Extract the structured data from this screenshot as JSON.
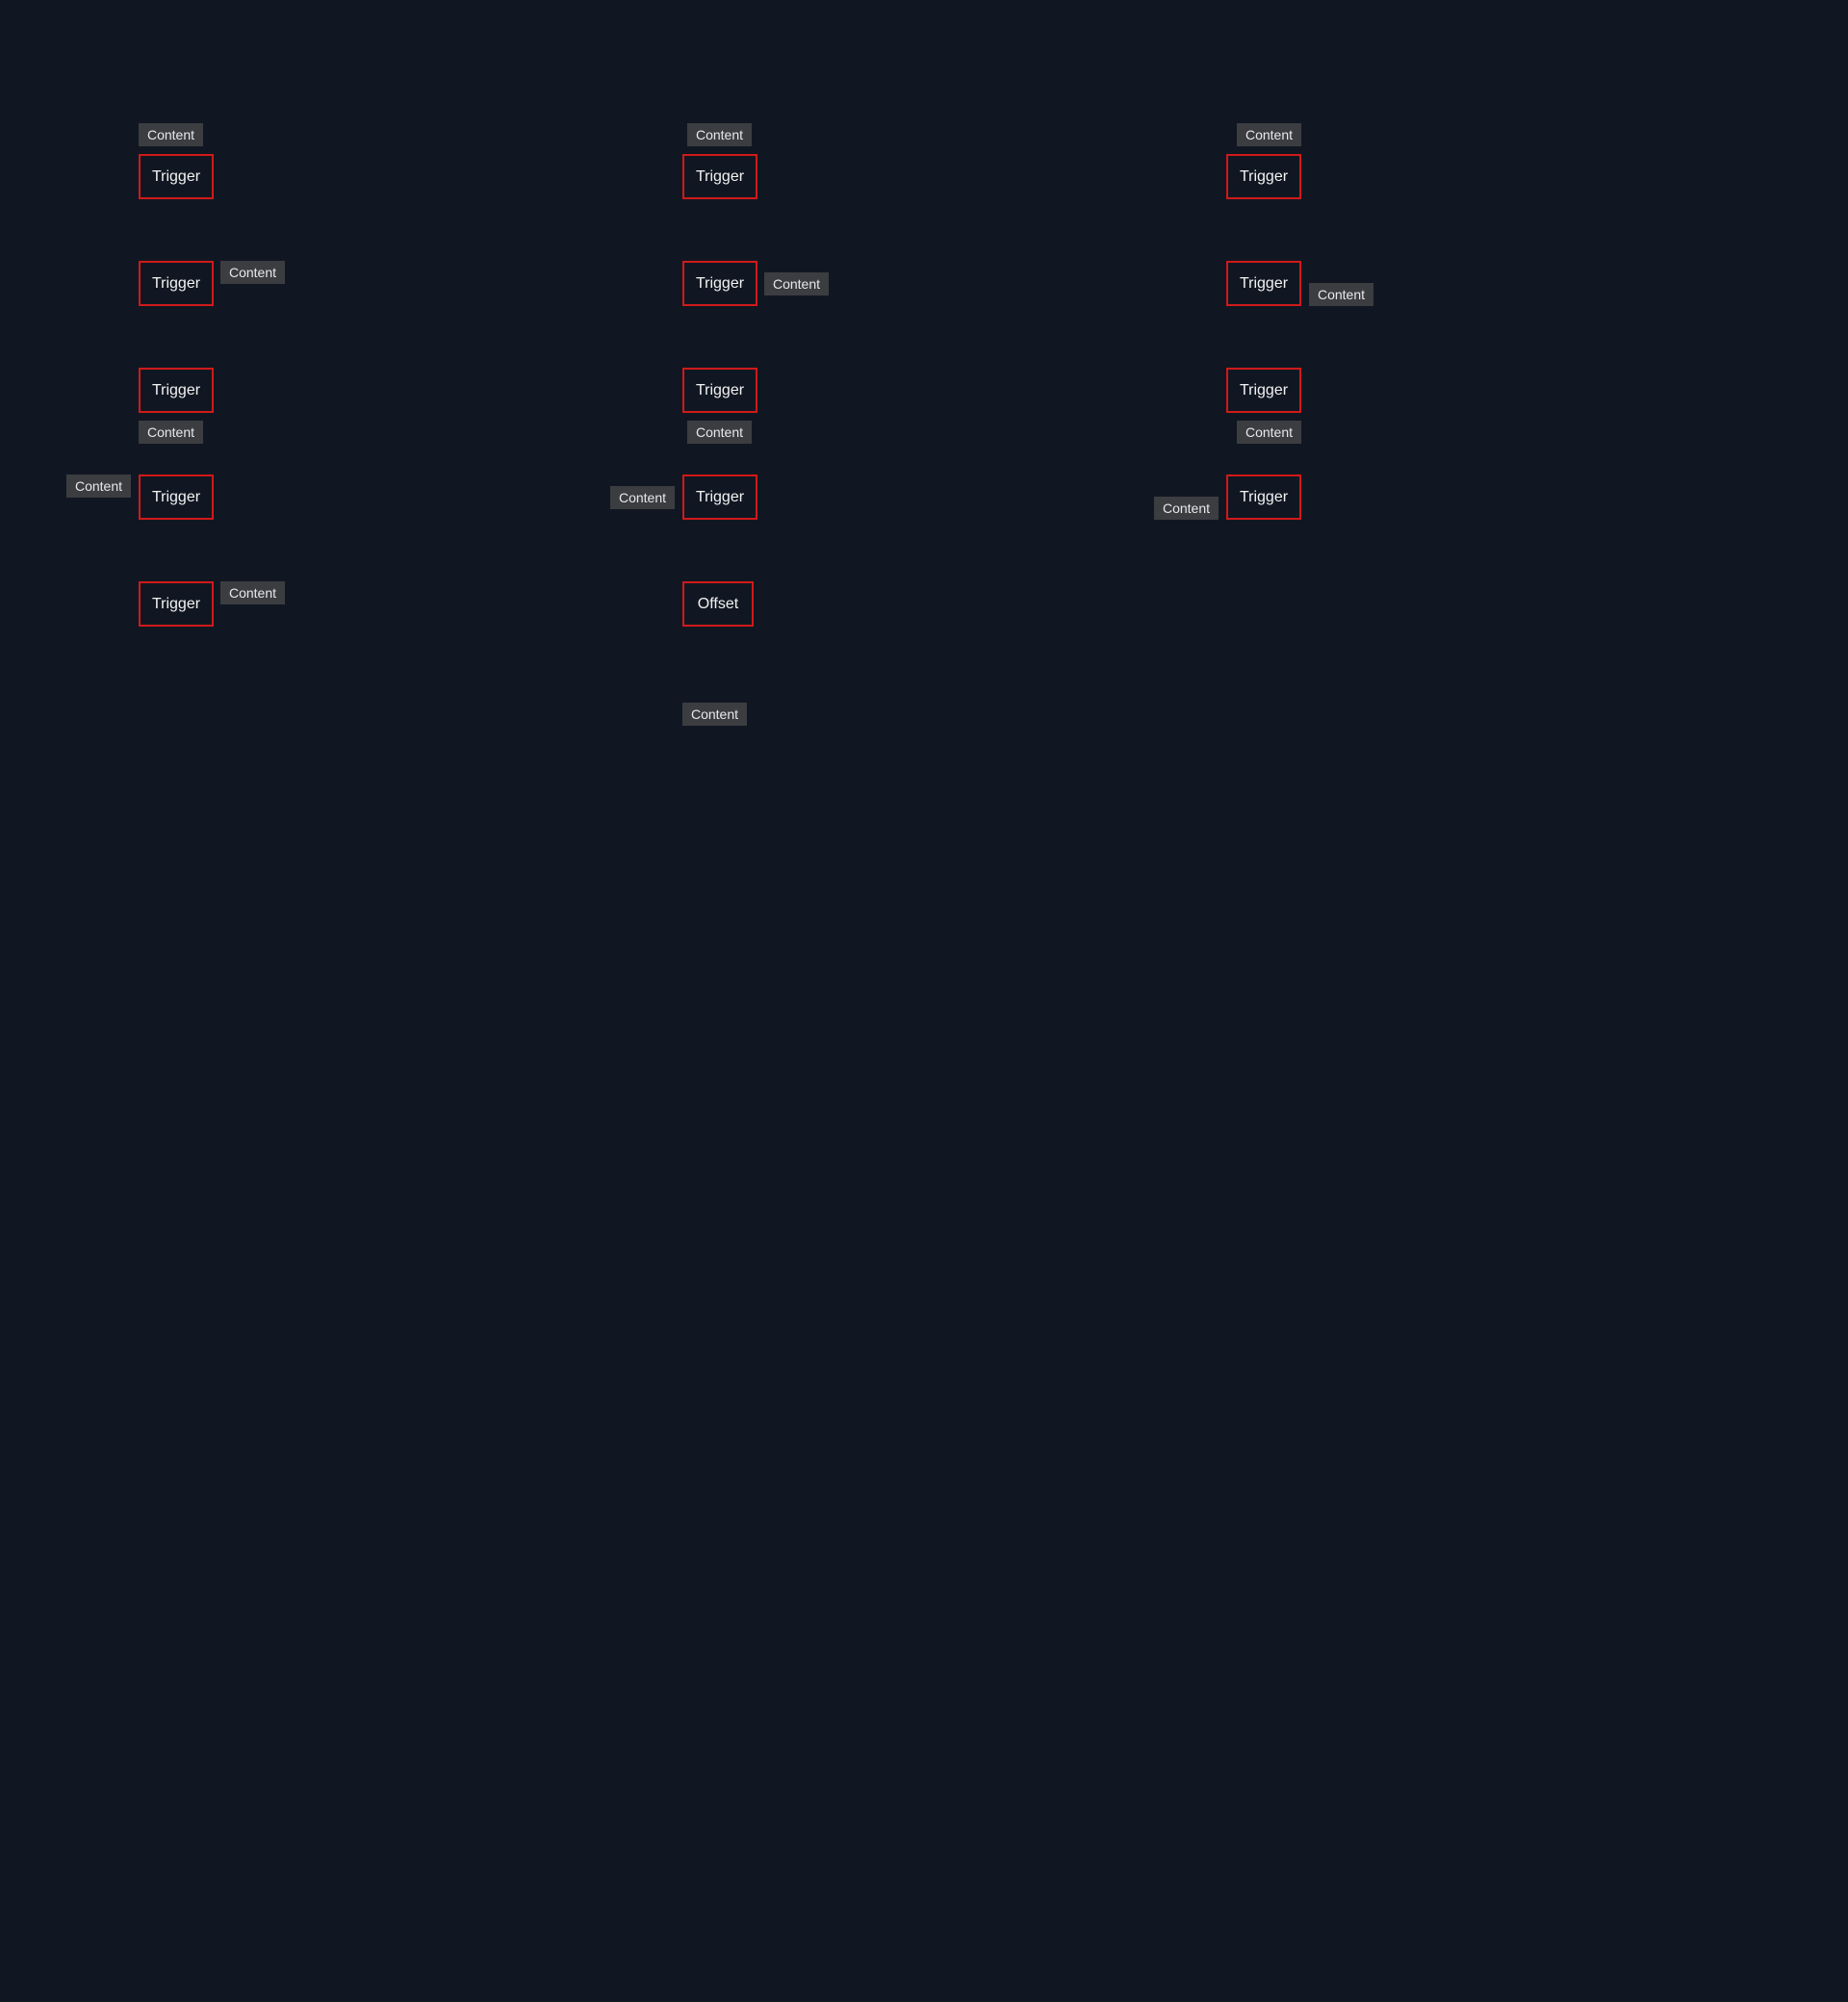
{
  "colors": {
    "background": "#111722",
    "trigger_border": "#d01a1a",
    "trigger_text": "#f2f2f2",
    "content_background": "#3b3d41",
    "content_text": "#e8e8e8"
  },
  "columns": [
    {
      "rows": [
        {
          "trigger": "Trigger",
          "content": "Content"
        },
        {
          "trigger": "Trigger",
          "content": "Content"
        },
        {
          "trigger": "Trigger",
          "content": "Content"
        },
        {
          "trigger": "Trigger",
          "content": "Content"
        },
        {
          "trigger": "Trigger",
          "content": "Content"
        }
      ]
    },
    {
      "rows": [
        {
          "trigger": "Trigger",
          "content": "Content"
        },
        {
          "trigger": "Trigger",
          "content": "Content"
        },
        {
          "trigger": "Trigger",
          "content": "Content"
        },
        {
          "trigger": "Trigger",
          "content": "Content"
        },
        {
          "trigger": "Offset",
          "content": "Content"
        }
      ]
    },
    {
      "rows": [
        {
          "trigger": "Trigger",
          "content": "Content"
        },
        {
          "trigger": "Trigger",
          "content": "Content"
        },
        {
          "trigger": "Trigger",
          "content": "Content"
        },
        {
          "trigger": "Trigger",
          "content": "Content"
        }
      ]
    }
  ]
}
